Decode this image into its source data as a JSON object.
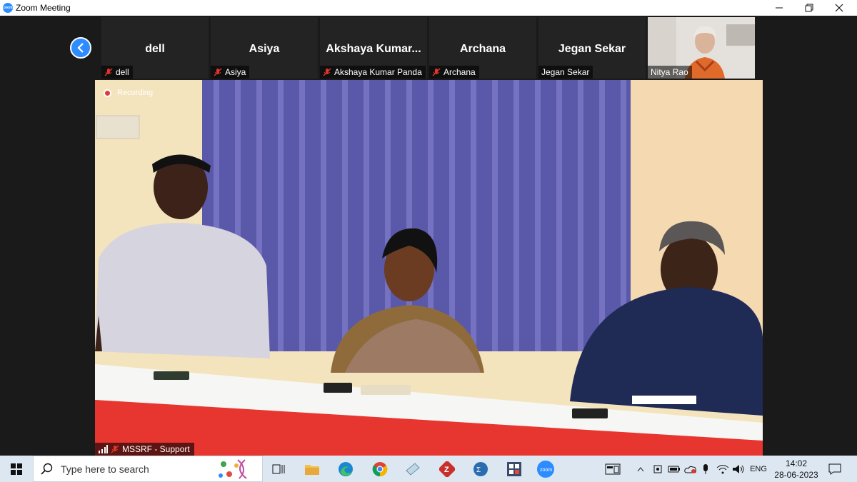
{
  "window": {
    "title": "Zoom Meeting"
  },
  "participants": [
    {
      "big_name": "dell",
      "label": "dell",
      "muted": true
    },
    {
      "big_name": "Asiya",
      "label": "Asiya",
      "muted": true
    },
    {
      "big_name": "Akshaya  Kumar...",
      "label": "Akshaya Kumar Panda",
      "muted": true
    },
    {
      "big_name": "Archana",
      "label": "Archana",
      "muted": true
    },
    {
      "big_name": "Jegan Sekar",
      "label": "Jegan Sekar",
      "muted": false
    },
    {
      "big_name": "",
      "label": "Nitya Rao",
      "muted": false
    }
  ],
  "main_video": {
    "recording_label": "Recording",
    "name_label": "MSSRF - Support"
  },
  "taskbar": {
    "search_placeholder": "Type here to search",
    "tray_lang": "ENG",
    "time": "14:02",
    "date": "28-06-2023"
  },
  "colors": {
    "zoom_blue": "#2d8cff",
    "recording_red": "#e03a3a",
    "muted_red": "#e0352b"
  }
}
